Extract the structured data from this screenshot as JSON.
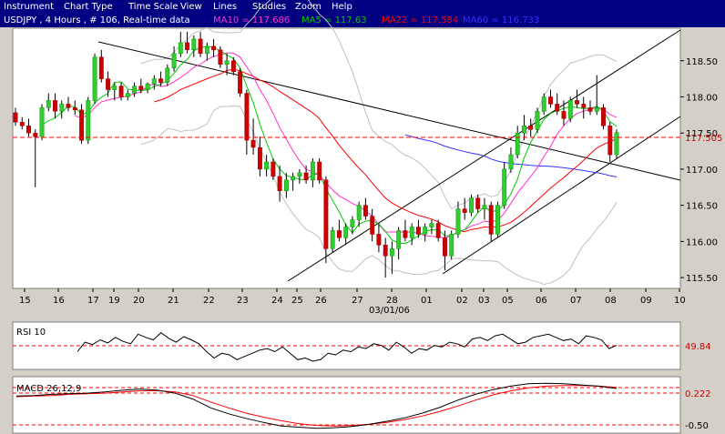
{
  "menu": {
    "items": [
      "Instrument",
      "Chart Type",
      "Time Scale",
      "View",
      "Lines",
      "Studies",
      "Zoom",
      "Help"
    ]
  },
  "info": {
    "symbol": "USDJPY , 4 Hours , # 106, Real-time data",
    "ma10": "MA10 = 117.686",
    "ma5": "MA5 = 117.63",
    "ma22": "MA22 = 117.584",
    "ma60": "MA60 = 116.733",
    "colors": {
      "ma10": "#ff33cc",
      "ma5": "#00cc00",
      "ma22": "#ff0000",
      "ma60": "#3333ff",
      "symbol": "#ffffff"
    }
  },
  "chart_data": [
    {
      "type": "candlestick",
      "title": "USDJPY , 4 Hours",
      "current_price": "117.505",
      "y_ticks": [
        "118.50",
        "118.00",
        "117.50",
        "117.00",
        "116.50",
        "116.00",
        "115.50"
      ],
      "ylim": [
        115.35,
        118.95
      ],
      "x_ticks": [
        "15",
        "16",
        "17",
        "19",
        "20",
        "21",
        "22",
        "23",
        "24",
        "25",
        "26",
        "27",
        "28",
        "01",
        "02",
        "03",
        "05",
        "06",
        "07",
        "08",
        "09",
        "10"
      ],
      "x_sublabel": "03/01/06",
      "series": [
        {
          "name": "MA10",
          "color": "#ff33cc"
        },
        {
          "name": "MA5",
          "color": "#00cc00"
        },
        {
          "name": "MA22",
          "color": "#ff0000"
        },
        {
          "name": "MA60",
          "color": "#3333ff"
        }
      ],
      "candles": [
        [
          117.78,
          117.85,
          117.6,
          117.65
        ],
        [
          117.65,
          117.72,
          117.55,
          117.6
        ],
        [
          117.6,
          117.7,
          117.45,
          117.5
        ],
        [
          117.5,
          117.55,
          116.75,
          117.45
        ],
        [
          117.45,
          117.9,
          117.4,
          117.85
        ],
        [
          117.85,
          118.05,
          117.8,
          117.95
        ],
        [
          117.95,
          118.05,
          117.7,
          117.8
        ],
        [
          117.8,
          117.95,
          117.7,
          117.9
        ],
        [
          117.9,
          118.0,
          117.8,
          117.85
        ],
        [
          117.85,
          117.95,
          117.75,
          117.82
        ],
        [
          117.82,
          117.9,
          117.35,
          117.4
        ],
        [
          117.4,
          118.0,
          117.35,
          117.95
        ],
        [
          117.95,
          118.6,
          117.9,
          118.55
        ],
        [
          118.55,
          118.65,
          118.2,
          118.25
        ],
        [
          118.25,
          118.35,
          118.0,
          118.1
        ],
        [
          118.1,
          118.2,
          117.95,
          118.15
        ],
        [
          118.15,
          118.2,
          117.95,
          118.0
        ],
        [
          118.0,
          118.1,
          117.95,
          118.05
        ],
        [
          118.05,
          118.2,
          118.0,
          118.15
        ],
        [
          118.15,
          118.25,
          118.05,
          118.1
        ],
        [
          118.1,
          118.2,
          118.05,
          118.18
        ],
        [
          118.18,
          118.3,
          118.1,
          118.25
        ],
        [
          118.25,
          118.35,
          118.15,
          118.2
        ],
        [
          118.2,
          118.45,
          118.15,
          118.4
        ],
        [
          118.4,
          118.7,
          118.35,
          118.6
        ],
        [
          118.6,
          118.9,
          118.55,
          118.75
        ],
        [
          118.75,
          118.9,
          118.6,
          118.65
        ],
        [
          118.65,
          118.85,
          118.55,
          118.8
        ],
        [
          118.8,
          118.9,
          118.55,
          118.6
        ],
        [
          118.6,
          118.75,
          118.5,
          118.7
        ],
        [
          118.7,
          118.8,
          118.55,
          118.65
        ],
        [
          118.65,
          118.7,
          118.4,
          118.45
        ],
        [
          118.45,
          118.6,
          118.3,
          118.5
        ],
        [
          118.5,
          118.55,
          118.3,
          118.35
        ],
        [
          118.35,
          118.4,
          118.0,
          118.05
        ],
        [
          118.05,
          118.1,
          117.2,
          117.4
        ],
        [
          117.4,
          117.7,
          117.2,
          117.3
        ],
        [
          117.3,
          117.45,
          116.9,
          117.0
        ],
        [
          117.0,
          117.2,
          116.9,
          117.1
        ],
        [
          117.1,
          117.15,
          116.85,
          116.9
        ],
        [
          116.9,
          117.05,
          116.55,
          116.7
        ],
        [
          116.7,
          116.95,
          116.6,
          116.85
        ],
        [
          116.85,
          116.95,
          116.7,
          116.9
        ],
        [
          116.9,
          117.0,
          116.8,
          116.95
        ],
        [
          116.95,
          117.05,
          116.8,
          116.85
        ],
        [
          116.85,
          117.15,
          116.75,
          117.1
        ],
        [
          117.1,
          117.15,
          116.8,
          116.85
        ],
        [
          116.85,
          116.9,
          115.7,
          115.9
        ],
        [
          115.9,
          116.2,
          115.85,
          116.15
        ],
        [
          116.15,
          116.3,
          116.0,
          116.05
        ],
        [
          116.05,
          116.25,
          115.95,
          116.2
        ],
        [
          116.2,
          116.35,
          116.1,
          116.3
        ],
        [
          116.3,
          116.55,
          116.2,
          116.5
        ],
        [
          116.5,
          116.6,
          116.3,
          116.35
        ],
        [
          116.35,
          116.45,
          116.0,
          116.1
        ],
        [
          116.1,
          116.25,
          115.85,
          115.95
        ],
        [
          115.95,
          116.05,
          115.5,
          115.8
        ],
        [
          115.8,
          116.0,
          115.55,
          115.9
        ],
        [
          115.9,
          116.2,
          115.75,
          116.15
        ],
        [
          116.15,
          116.3,
          116.0,
          116.05
        ],
        [
          116.05,
          116.25,
          115.95,
          116.2
        ],
        [
          116.2,
          116.3,
          116.05,
          116.1
        ],
        [
          116.1,
          116.25,
          116.0,
          116.2
        ],
        [
          116.2,
          116.3,
          116.1,
          116.25
        ],
        [
          116.25,
          116.3,
          116.0,
          116.05
        ],
        [
          116.05,
          116.15,
          115.6,
          115.8
        ],
        [
          115.8,
          116.15,
          115.75,
          116.1
        ],
        [
          116.1,
          116.55,
          116.05,
          116.45
        ],
        [
          116.45,
          116.6,
          116.3,
          116.4
        ],
        [
          116.4,
          116.65,
          116.35,
          116.6
        ],
        [
          116.6,
          116.65,
          116.4,
          116.45
        ],
        [
          116.45,
          116.6,
          116.3,
          116.5
        ],
        [
          116.5,
          116.55,
          116.0,
          116.1
        ],
        [
          116.1,
          116.55,
          116.05,
          116.5
        ],
        [
          116.5,
          117.1,
          116.45,
          117.0
        ],
        [
          117.0,
          117.3,
          116.95,
          117.2
        ],
        [
          117.2,
          117.6,
          117.15,
          117.5
        ],
        [
          117.5,
          117.75,
          117.4,
          117.6
        ],
        [
          117.6,
          117.7,
          117.45,
          117.55
        ],
        [
          117.55,
          117.85,
          117.5,
          117.8
        ],
        [
          117.8,
          118.05,
          117.75,
          118.0
        ],
        [
          118.0,
          118.1,
          117.85,
          117.9
        ],
        [
          117.9,
          118.05,
          117.75,
          117.8
        ],
        [
          117.8,
          117.95,
          117.6,
          117.7
        ],
        [
          117.7,
          118.0,
          117.65,
          117.95
        ],
        [
          117.95,
          118.1,
          117.85,
          117.9
        ],
        [
          117.9,
          118.0,
          117.7,
          117.85
        ],
        [
          117.85,
          117.95,
          117.75,
          117.8
        ],
        [
          117.8,
          118.3,
          117.75,
          117.85
        ],
        [
          117.85,
          117.9,
          117.55,
          117.6
        ],
        [
          117.6,
          117.65,
          117.1,
          117.2
        ],
        [
          117.2,
          117.55,
          117.15,
          117.505
        ]
      ]
    },
    {
      "type": "line",
      "title": "RSI 10",
      "value_label": "49.84",
      "series": [
        {
          "name": "RSI 10",
          "values": [
            40,
            52,
            49,
            55,
            51,
            58,
            53,
            50,
            62,
            58,
            55,
            64,
            57,
            52,
            59,
            55,
            50,
            40,
            32,
            38,
            36,
            30,
            34,
            38,
            42,
            44,
            40,
            46,
            38,
            30,
            32,
            28,
            30,
            38,
            36,
            42,
            40,
            46,
            44,
            50,
            48,
            42,
            52,
            46,
            38,
            44,
            42,
            48,
            46,
            52,
            50,
            46,
            56,
            58,
            54,
            60,
            62,
            56,
            50,
            52,
            58,
            60,
            62,
            58,
            54,
            56,
            50,
            60,
            58,
            55,
            44,
            48
          ]
        }
      ]
    },
    {
      "type": "line",
      "title": "MACD 26,12,9",
      "value_labels": [
        "0.222",
        "-0.50"
      ],
      "series": [
        {
          "name": "MACD",
          "values": [
            0.05,
            0.06,
            0.08,
            0.09,
            0.1,
            0.12,
            0.15,
            0.17,
            0.15,
            0.1,
            0.0,
            -0.15,
            -0.25,
            -0.33,
            -0.4,
            -0.46,
            -0.48,
            -0.5,
            -0.49,
            -0.47,
            -0.43,
            -0.38,
            -0.32,
            -0.24,
            -0.14,
            -0.02,
            0.08,
            0.16,
            0.22,
            0.26,
            0.27,
            0.26,
            0.24,
            0.22,
            0.18
          ]
        },
        {
          "name": "Signal",
          "values": [
            0.04,
            0.05,
            0.06,
            0.08,
            0.09,
            0.1,
            0.12,
            0.14,
            0.14,
            0.12,
            0.06,
            -0.05,
            -0.15,
            -0.24,
            -0.31,
            -0.37,
            -0.42,
            -0.45,
            -0.46,
            -0.45,
            -0.43,
            -0.4,
            -0.35,
            -0.29,
            -0.21,
            -0.12,
            -0.02,
            0.07,
            0.14,
            0.19,
            0.22,
            0.23,
            0.23,
            0.22,
            0.2
          ]
        }
      ]
    }
  ]
}
